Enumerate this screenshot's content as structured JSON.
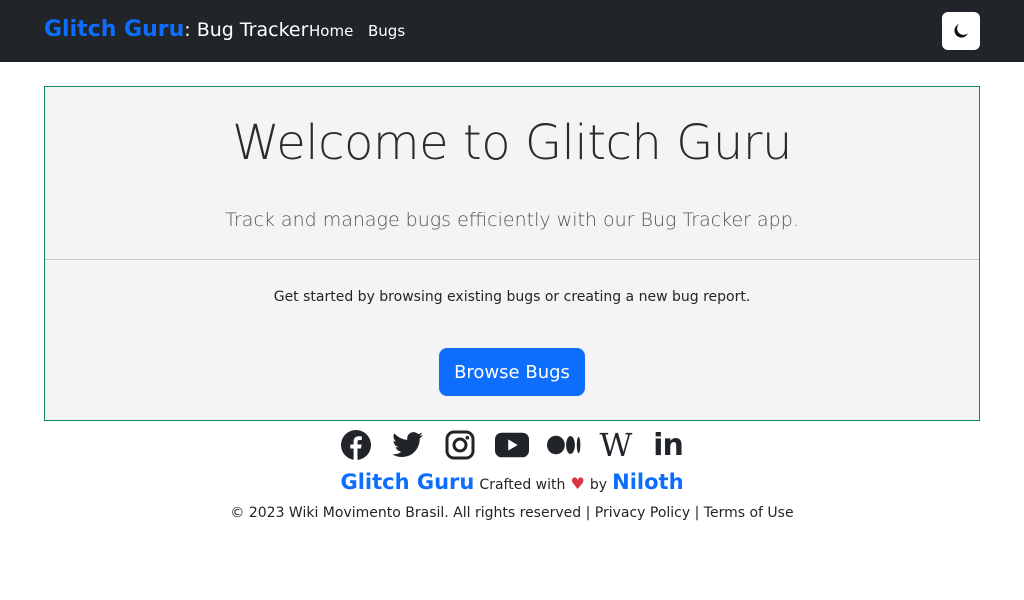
{
  "navbar": {
    "brand_main": "Glitch Guru",
    "brand_sub": ": Bug Tracker",
    "links": [
      "Home",
      "Bugs"
    ],
    "theme_toggle_icon": "moon-icon"
  },
  "hero": {
    "title": "Welcome to Glitch Guru",
    "lead": "Track and manage bugs efficiently with our Bug Tracker app.",
    "text": "Get started by browsing existing bugs or creating a new bug report.",
    "button_label": "Browse Bugs"
  },
  "social": {
    "icons": [
      "facebook-icon",
      "twitter-icon",
      "instagram-icon",
      "youtube-icon",
      "medium-icon",
      "wikipedia-icon",
      "linkedin-icon"
    ],
    "wikipedia_glyph": "W",
    "linkedin_glyph": "in"
  },
  "footer": {
    "brand": "Glitch Guru",
    "crafted": "Crafted with",
    "heart": "♥",
    "by": "by",
    "author": "Niloth",
    "copyright": "© 2023 Wiki Movimento Brasil. All rights reserved",
    "separator": "|",
    "privacy": "Privacy Policy",
    "terms": "Terms of Use"
  },
  "colors": {
    "navbar_bg": "#212529",
    "accent": "#0d6efd",
    "hero_border": "#198754",
    "hero_bg": "#f4f4f4"
  }
}
